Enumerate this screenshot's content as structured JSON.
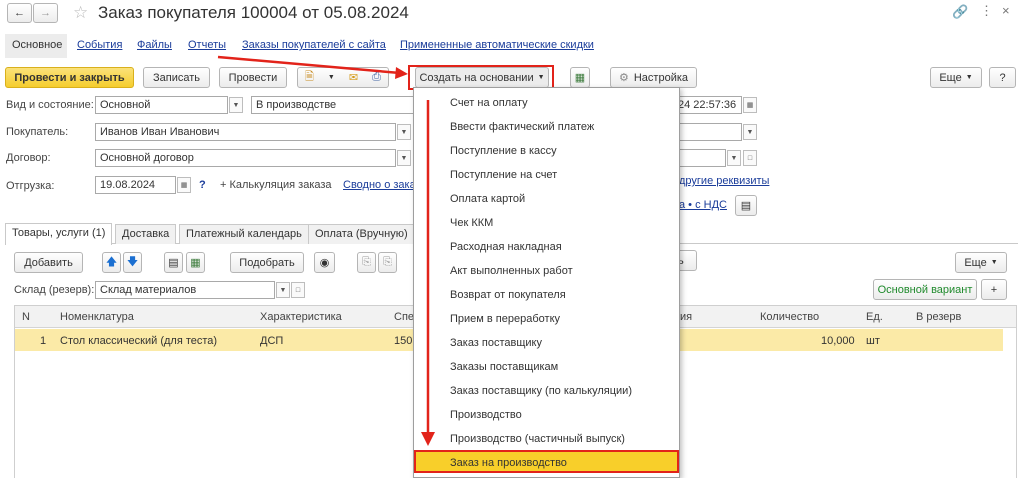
{
  "window": {
    "title": "Заказ покупателя 100004 от 05.08.2024",
    "back_icon": "arrow-left",
    "forward_icon": "arrow-right",
    "star_icon": "star-outline",
    "link_icon": "link",
    "more_icon": "vertical-dots",
    "close_icon": "close"
  },
  "nav_tabs": {
    "main": "Основное",
    "events": "События",
    "files": "Файлы",
    "reports": "Отчеты",
    "site_orders": "Заказы покупателей с сайта",
    "discounts": "Примененные автоматические скидки"
  },
  "toolbar": {
    "post_close": "Провести и закрыть",
    "save": "Записать",
    "post": "Провести",
    "create_based": "Создать на основании",
    "settings": "Настройка",
    "more": "Еще",
    "help": "?"
  },
  "form": {
    "status_label": "Вид и состояние:",
    "status_kind": "Основной",
    "status_state": "В производстве",
    "date_value": "24 22:57:36",
    "buyer_label": "Покупатель:",
    "buyer_value": "Иванов Иван Иванович",
    "contract_label": "Договор:",
    "contract_value": "Основной договор",
    "shipment_label": "Отгрузка:",
    "shipment_date": "19.08.2024",
    "question": "?",
    "calc_label": "+ Калькуляция заказа",
    "calc_link": "Сводно о зака",
    "other_props": "другие реквизиты",
    "vat_link": "а • с НДС"
  },
  "tabs": {
    "goods": "Товары, услуги (1)",
    "delivery": "Доставка",
    "payment_calendar": "Платежный календарь",
    "payment_manual": "Оплата (Вручную)"
  },
  "table_toolbar": {
    "add": "Добавить",
    "pick": "Подобрать",
    "partial": "ь",
    "more": "Еще",
    "warehouse_label": "Склад (резерв):",
    "warehouse_value": "Склад материалов",
    "variant": "Основной вариант",
    "plus": "+"
  },
  "table": {
    "headers": {
      "n": "N",
      "nomenclature": "Номенклатура",
      "characteristic": "Характеристика",
      "spec": "Спе",
      "extra": "ия",
      "quantity": "Количество",
      "unit": "Ед.",
      "reserve": "В резерв"
    },
    "rows": [
      {
        "n": "1",
        "nomenclature": "Стол классический (для теста)",
        "characteristic": "ДСП",
        "spec": "150",
        "quantity": "10,000",
        "unit": "шт"
      }
    ]
  },
  "menu": {
    "items": [
      "Счет на оплату",
      "Ввести фактический платеж",
      "Поступление в кассу",
      "Поступление на счет",
      "Оплата картой",
      "Чек ККМ",
      "Расходная накладная",
      "Акт выполненных работ",
      "Возврат от покупателя",
      "Прием в переработку",
      "Заказ поставщику",
      "Заказы поставщикам",
      "Заказ поставщику (по калькуляции)",
      "Производство",
      "Производство (частичный выпуск)",
      "Заказ на производство"
    ],
    "selected_index": 15
  },
  "colors": {
    "highlight_red": "#e2231a",
    "selected_yellow": "#f8cf2a",
    "row_yellow": "#fbeaa7",
    "accent_green": "#1f8a2c"
  }
}
